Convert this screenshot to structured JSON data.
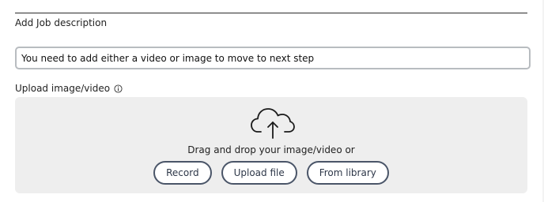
{
  "section": {
    "title": "Add Job description"
  },
  "message_field": {
    "value": "You need to add either a video or image to move to next step"
  },
  "upload": {
    "label": "Upload image/video",
    "info_icon": "info-icon",
    "cloud_icon": "cloud-upload-icon",
    "drop_text": "Drag and drop your image/video or",
    "buttons": {
      "record": "Record",
      "upload_file": "Upload file",
      "from_library": "From library"
    }
  },
  "colors": {
    "button_border": "#4a5568",
    "dropzone_bg": "#eeeeee",
    "field_border": "#b8bcc0"
  }
}
